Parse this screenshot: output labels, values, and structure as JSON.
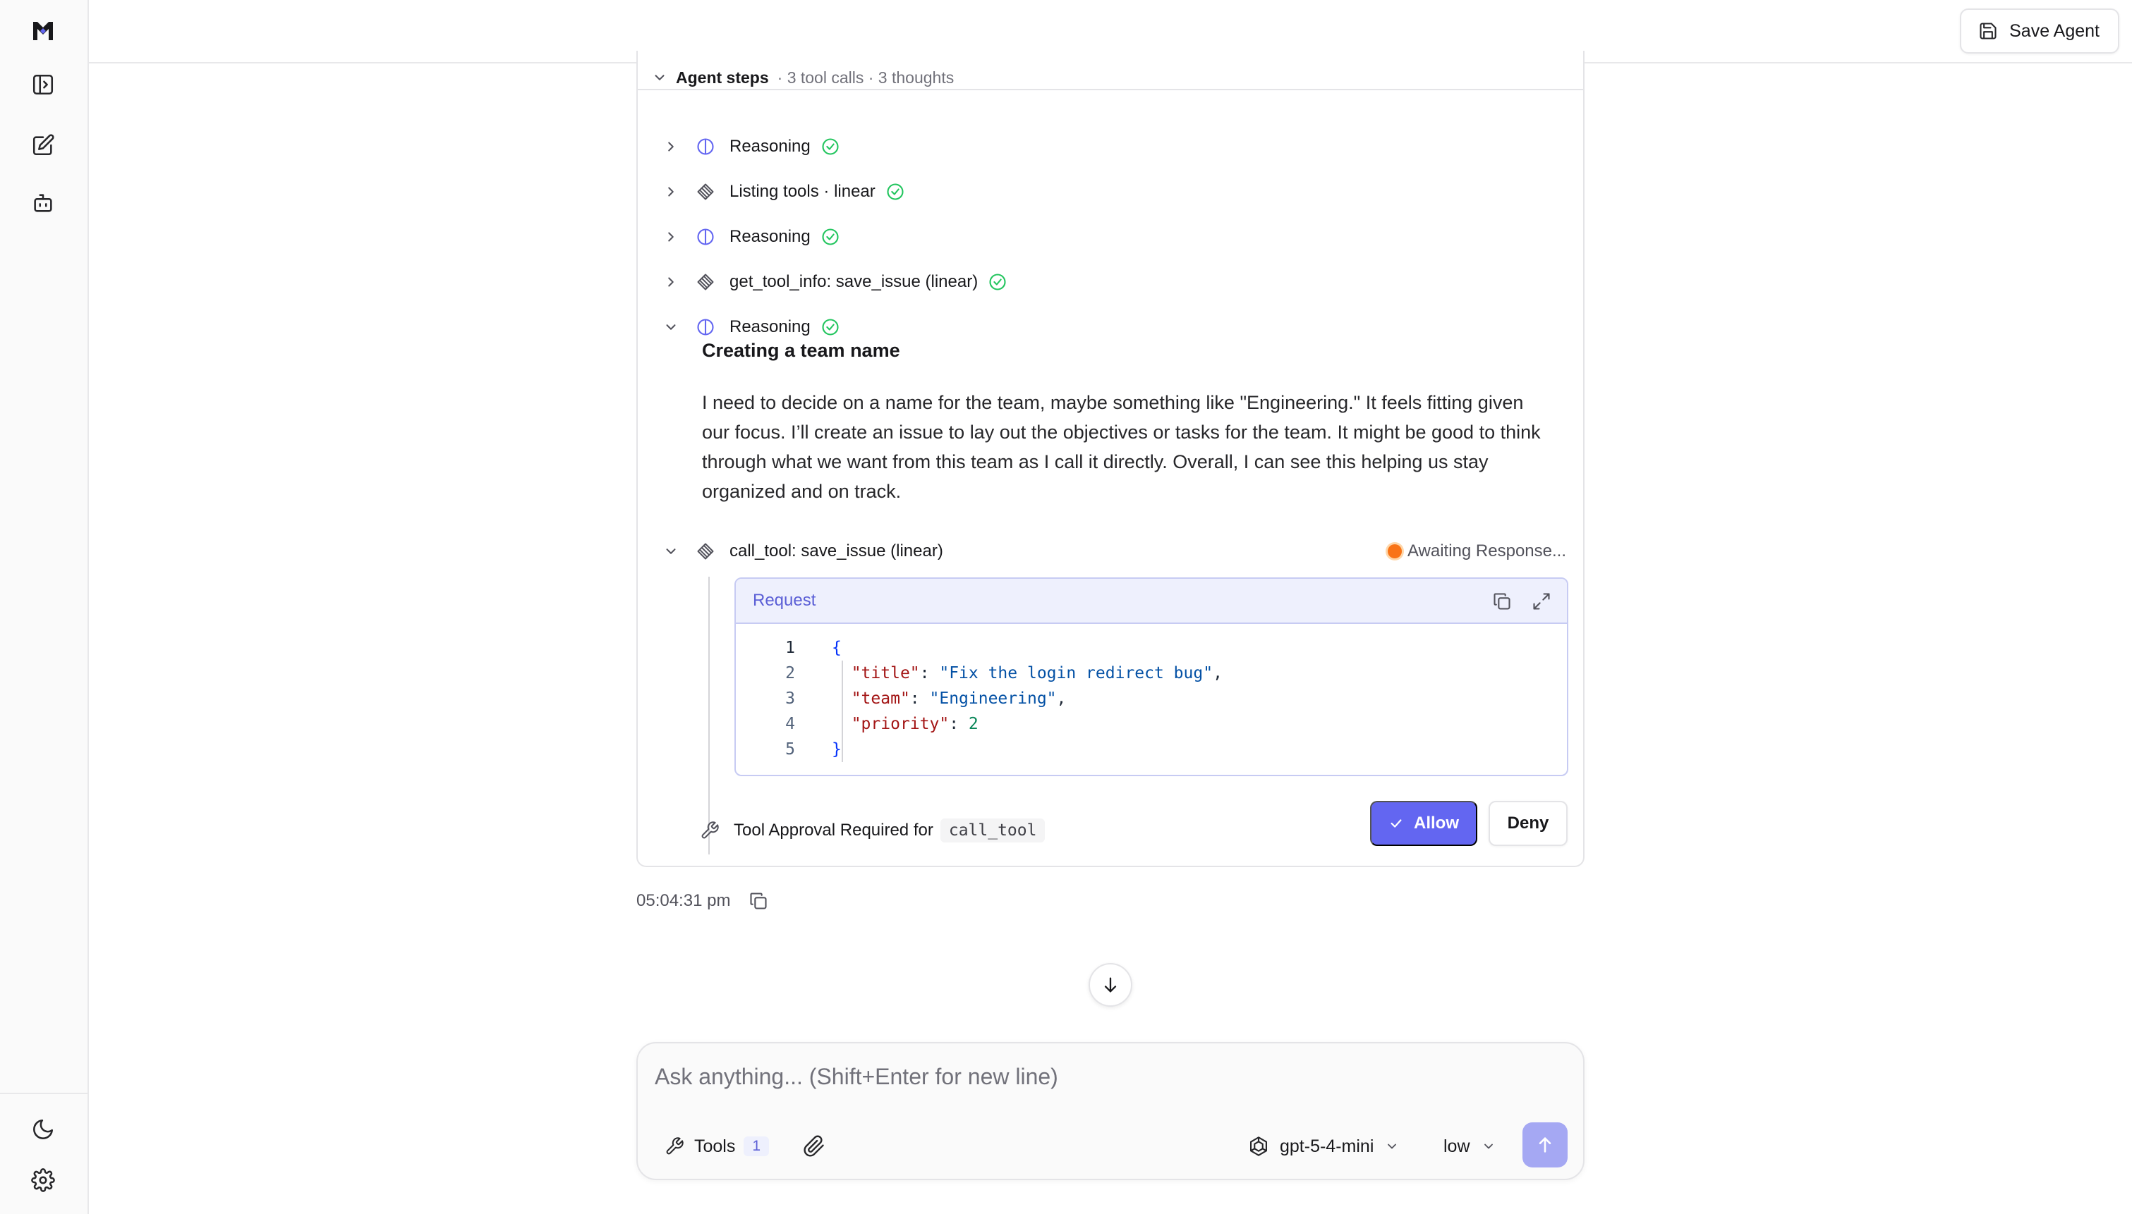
{
  "topbar": {
    "save_agent_label": "Save Agent"
  },
  "agent_steps": {
    "title": "Agent steps",
    "meta": "· 3 tool calls · 3 thoughts",
    "steps": [
      {
        "label": "Reasoning",
        "icon": "reasoning-icon",
        "status": "done",
        "expanded": false
      },
      {
        "label": "Listing tools · linear",
        "icon": "tool-icon",
        "status": "done",
        "expanded": false
      },
      {
        "label": "Reasoning",
        "icon": "reasoning-icon",
        "status": "done",
        "expanded": false
      },
      {
        "label": "get_tool_info: save_issue (linear)",
        "icon": "tool-icon",
        "status": "done",
        "expanded": false
      },
      {
        "label": "Reasoning",
        "icon": "reasoning-icon",
        "status": "done",
        "expanded": true
      }
    ],
    "reasoning": {
      "title": "Creating a team name",
      "body": "I need to decide on a name for the team, maybe something like \"Engineering.\" It feels fitting given our focus. I’ll create an issue to lay out the objectives or tasks for the team. It might be good to think through what we want from this team as I call it directly. Overall, I can see this helping us stay organized and on track."
    },
    "tool_call": {
      "label": "call_tool: save_issue (linear)",
      "status_text": "Awaiting Response...",
      "status_color": "#f97316",
      "request": {
        "title": "Request",
        "line_numbers": [
          "1",
          "2",
          "3",
          "4",
          "5"
        ],
        "lines": {
          "open": "{",
          "title_key": "\"title\"",
          "title_value": "\"Fix the login redirect bug\"",
          "team_key": "\"team\"",
          "team_value": "\"Engineering\"",
          "priority_key": "\"priority\"",
          "priority_value": "2",
          "close": "}"
        }
      },
      "approval": {
        "text": "Tool Approval Required for",
        "tool_name": "call_tool",
        "allow_label": "Allow",
        "deny_label": "Deny"
      }
    }
  },
  "message_time": "05:04:31 pm",
  "composer": {
    "placeholder": "Ask anything... (Shift+Enter for new line)",
    "tools_label": "Tools",
    "tools_count": "1",
    "model": "gpt-5-4-mini",
    "effort": "low"
  },
  "colors": {
    "accent": "#6366f1",
    "success": "#22c55e",
    "pending": "#f97316"
  }
}
